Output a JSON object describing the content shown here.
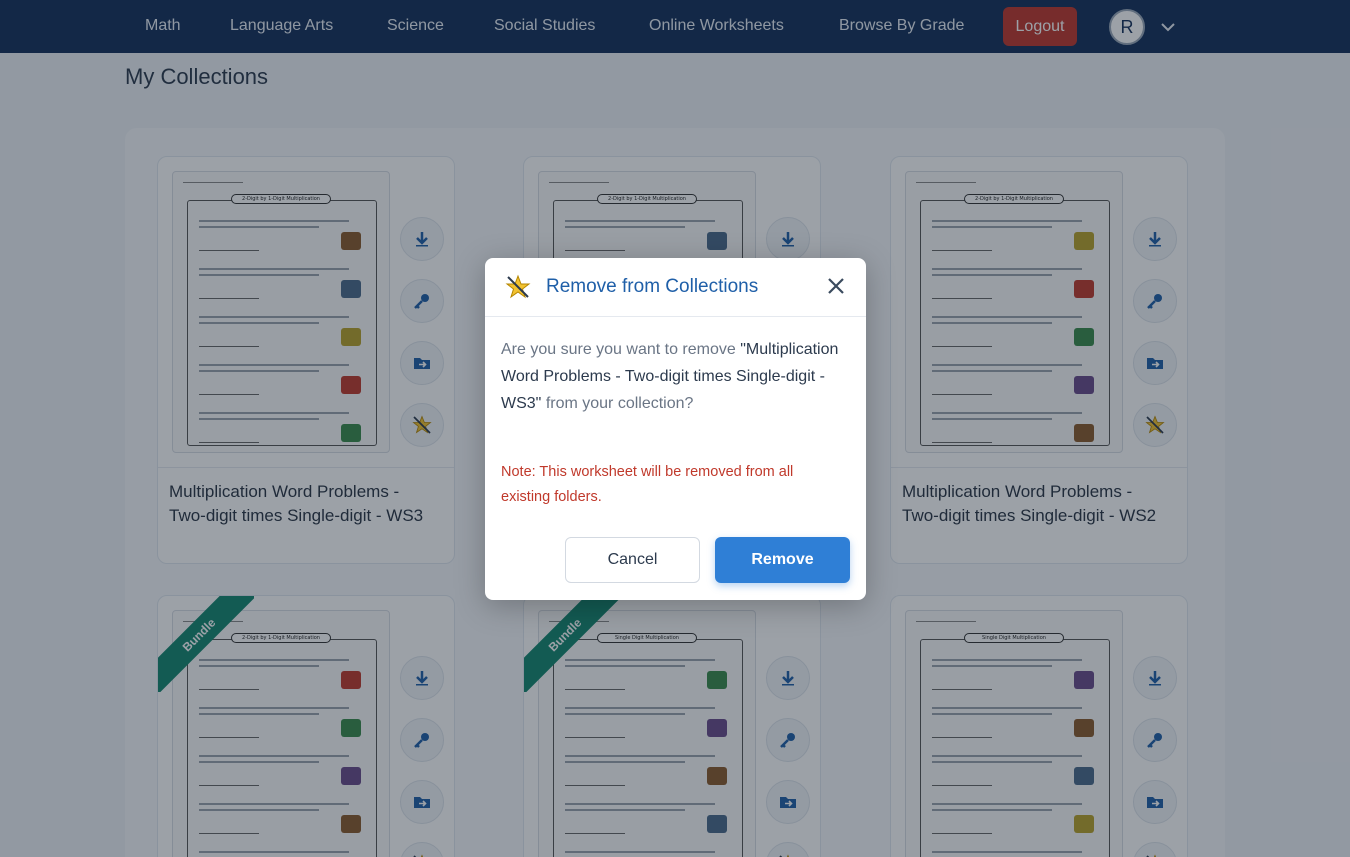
{
  "nav": {
    "items": [
      "Math",
      "Language Arts",
      "Science",
      "Social Studies",
      "Online Worksheets",
      "Browse By Grade"
    ],
    "logout": "Logout",
    "avatar_initial": "R"
  },
  "page": {
    "title": "My Collections"
  },
  "cards": [
    {
      "title": "Multiplication Word Problems - Two-digit times Single-digit - WS3",
      "sheet_title": "2-Digit by 1-Digit Multiplication",
      "bundle": ""
    },
    {
      "title": "",
      "sheet_title": "2-Digit by 1-Digit Multiplication",
      "bundle": ""
    },
    {
      "title": "Multiplication Word Problems - Two-digit times Single-digit - WS2",
      "sheet_title": "2-Digit by 1-Digit Multiplication",
      "bundle": ""
    },
    {
      "title": "",
      "sheet_title": "2-Digit by 1-Digit Multiplication",
      "bundle": "Bundle"
    },
    {
      "title": "",
      "sheet_title": "Single Digit Multiplication",
      "bundle": "Bundle"
    },
    {
      "title": "",
      "sheet_title": "Single Digit Multiplication",
      "bundle": ""
    }
  ],
  "card_actions": [
    "download-icon",
    "key-icon",
    "move-to-folder-icon",
    "remove-star-icon"
  ],
  "modal": {
    "title": "Remove from Collections",
    "body_prefix": "Are you sure you want to remove",
    "item_name": "\"Multiplication Word Problems - Two-digit times Single-digit - WS3\"",
    "body_suffix": "from your collection?",
    "note": "Note: This worksheet will be removed from all existing folders.",
    "cancel_label": "Cancel",
    "remove_label": "Remove"
  },
  "colors": {
    "nav_bg": "#14305a",
    "logout_bg": "#c0362c",
    "primary": "#2f7fd6",
    "ribbon": "#13876e",
    "warning_text": "#c0392b"
  }
}
